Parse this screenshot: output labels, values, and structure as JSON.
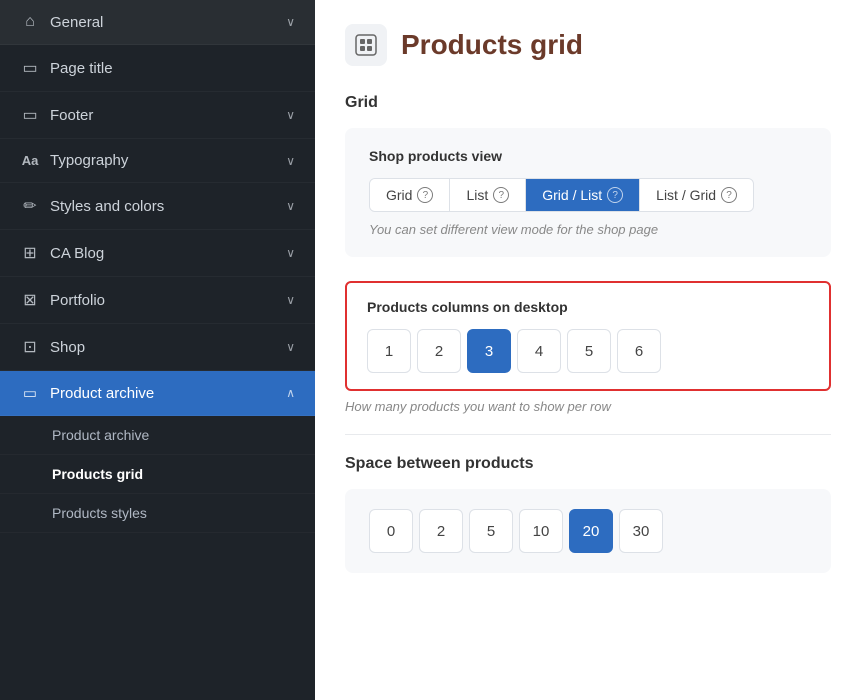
{
  "sidebar": {
    "items": [
      {
        "id": "general",
        "label": "General",
        "icon": "⌂",
        "hasChevron": true,
        "active": false
      },
      {
        "id": "page-title",
        "label": "Page title",
        "icon": "▭",
        "hasChevron": false,
        "active": false
      },
      {
        "id": "footer",
        "label": "Footer",
        "icon": "▭",
        "hasChevron": true,
        "active": false
      },
      {
        "id": "typography",
        "label": "Typography",
        "icon": "Aa",
        "hasChevron": true,
        "active": false
      },
      {
        "id": "styles-colors",
        "label": "Styles and colors",
        "icon": "✏",
        "hasChevron": true,
        "active": false
      },
      {
        "id": "blog",
        "label": "CA Blog",
        "icon": "⊞",
        "hasChevron": true,
        "active": false
      },
      {
        "id": "portfolio",
        "label": "Portfolio",
        "icon": "⊠",
        "hasChevron": true,
        "active": false
      },
      {
        "id": "shop",
        "label": "Shop",
        "icon": "⊡",
        "hasChevron": true,
        "active": false
      },
      {
        "id": "product-archive",
        "label": "Product archive",
        "icon": "▭",
        "hasChevron": true,
        "active": true
      }
    ],
    "subItems": [
      {
        "id": "product-archive-sub",
        "label": "Product archive",
        "active": false
      },
      {
        "id": "products-grid",
        "label": "Products grid",
        "active": true
      },
      {
        "id": "products-styles",
        "label": "Products styles",
        "active": false
      }
    ]
  },
  "main": {
    "title": "Products grid",
    "section1": "Grid",
    "shopProductsView": {
      "label": "Shop products view",
      "buttons": [
        "Grid",
        "List",
        "Grid / List",
        "List / Grid"
      ],
      "selected": "Grid / List",
      "hint": "You can set different view mode for the shop page"
    },
    "columnsDesktop": {
      "label": "Products columns on desktop",
      "values": [
        1,
        2,
        3,
        4,
        5,
        6
      ],
      "selected": 3,
      "hint": "How many products you want to show per row"
    },
    "spaceBetween": {
      "label": "Space between products",
      "values": [
        0,
        2,
        5,
        10,
        20,
        30
      ],
      "selected": 20
    }
  }
}
